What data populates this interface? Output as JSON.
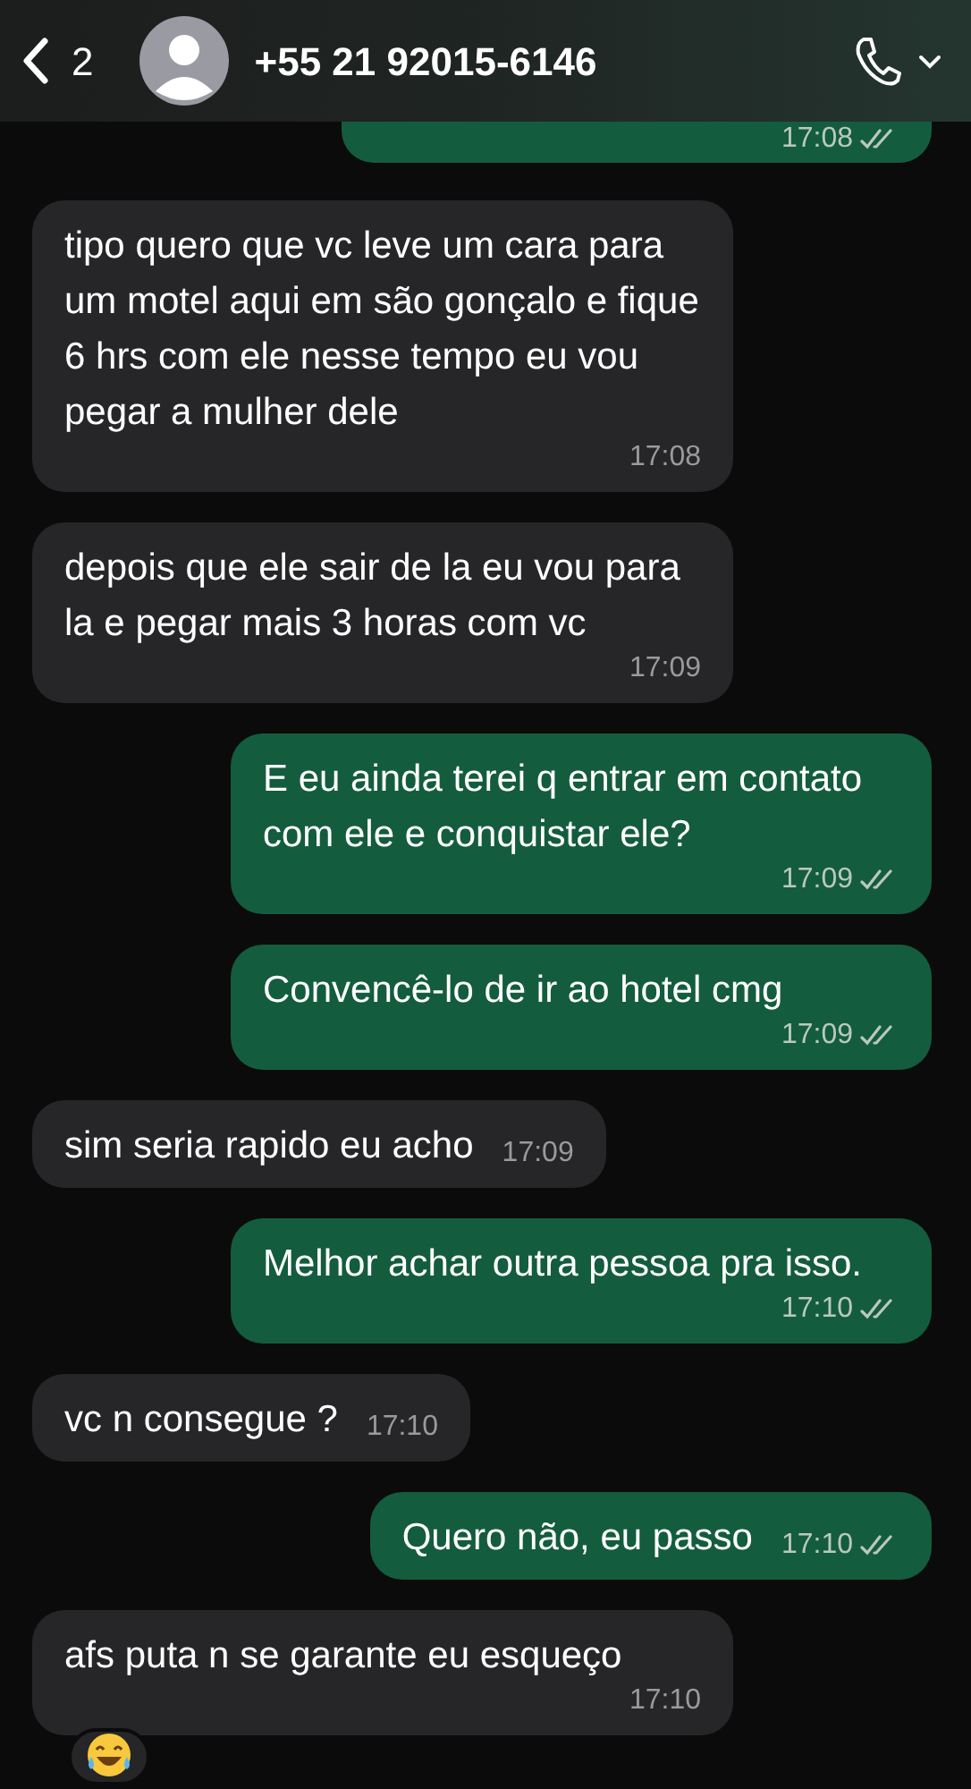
{
  "header": {
    "unread_count": "2",
    "title": "+55 21 92015-6146"
  },
  "messages": [
    {
      "kind": "outgoing",
      "time": "17:08",
      "double_tick": true
    },
    {
      "kind": "incoming",
      "text": "tipo quero que vc leve um cara para um motel aqui em são gonçalo e fique 6 hrs com ele nesse tempo eu vou pegar a mulher dele",
      "time": "17:08"
    },
    {
      "kind": "incoming",
      "text": "depois que ele sair de la eu vou para la e pegar mais 3 horas com vc",
      "time": "17:09"
    },
    {
      "kind": "outgoing",
      "text": "E eu ainda terei q entrar em contato com ele e conquistar ele?",
      "time": "17:09",
      "double_tick": true
    },
    {
      "kind": "outgoing",
      "text": "Convencê-lo de ir ao hotel cmg",
      "time": "17:09",
      "double_tick": true
    },
    {
      "kind": "incoming",
      "text": "sim seria rapido eu acho",
      "time": "17:09"
    },
    {
      "kind": "outgoing",
      "text": "Melhor achar outra pessoa pra isso.",
      "time": "17:10",
      "double_tick": true
    },
    {
      "kind": "incoming",
      "text": "vc n consegue ?",
      "time": "17:10"
    },
    {
      "kind": "outgoing",
      "text": "Quero não, eu passo",
      "time": "17:10",
      "double_tick": true
    },
    {
      "kind": "incoming",
      "text": "afs puta n se garante eu esqueço",
      "time": "17:10",
      "has_reaction": true
    }
  ]
}
